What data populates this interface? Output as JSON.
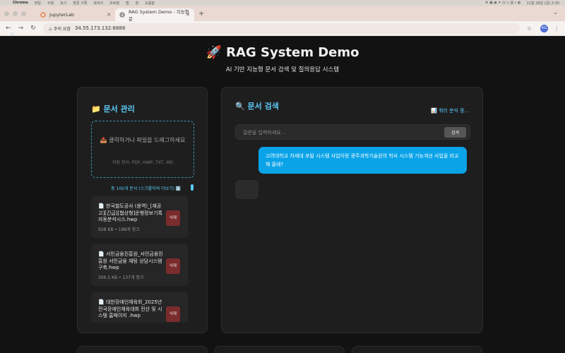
{
  "menubar": {
    "app": "Chrome",
    "items": [
      "파일",
      "수정",
      "보기",
      "방문 기록",
      "북마크",
      "프로필",
      "탭",
      "창",
      "도움말"
    ],
    "clock": "11월 28일 (금) 2:30"
  },
  "tabs": [
    {
      "label": "JupyterLab",
      "active": false
    },
    {
      "label": "RAG System Demo - 지능형 문",
      "active": true
    }
  ],
  "address": {
    "warning": "주의 요함",
    "url": "34.55.173.132:8888",
    "profile": "KG"
  },
  "page": {
    "title": "🚀 RAG System Demo",
    "subtitle": "AI 기반 지능형 문서 검색 및 질의응답 시스템"
  },
  "docs_panel": {
    "title": "📁 문서 관리",
    "dropzone_text": "📤 클릭하거나 파일을 드래그하세요",
    "formats": "지원 형식: PDF, HWP, TXT, MD",
    "count_text": "총 100개 문서 (스크롤하여 더보기) ⬇️",
    "items": [
      {
        "name": "📄 한국철도공사 (용역)_[재공고][긴급][협상형]운행정보기록 자동분석시스.hwp",
        "meta": "928 KB • 188개 청크",
        "delete": "삭제"
      },
      {
        "name": "📄 서민금융진흥원_서민금융진흥원 서민금융 채팅 상담시스템 구축.hwp",
        "meta": "306.5 KB • 137개 청크",
        "delete": "삭제"
      },
      {
        "name": "📄 대한장애인체육회_2025년 전국장애인체육대회 전산 및 시스템 홈페이지 .hwp",
        "meta": "",
        "delete": "삭제"
      }
    ]
  },
  "search_panel": {
    "title": "🔍 문서 검색",
    "status": "📊 쿼리 분석 중...",
    "placeholder": "질문을 입력하세요...",
    "search_label": "검색",
    "user_message": "고려대학교 차세대 포털 시스템 사업이랑 광주과학기술원의 학사 시스템 기능개선 사업을 비교해 줄래?"
  }
}
